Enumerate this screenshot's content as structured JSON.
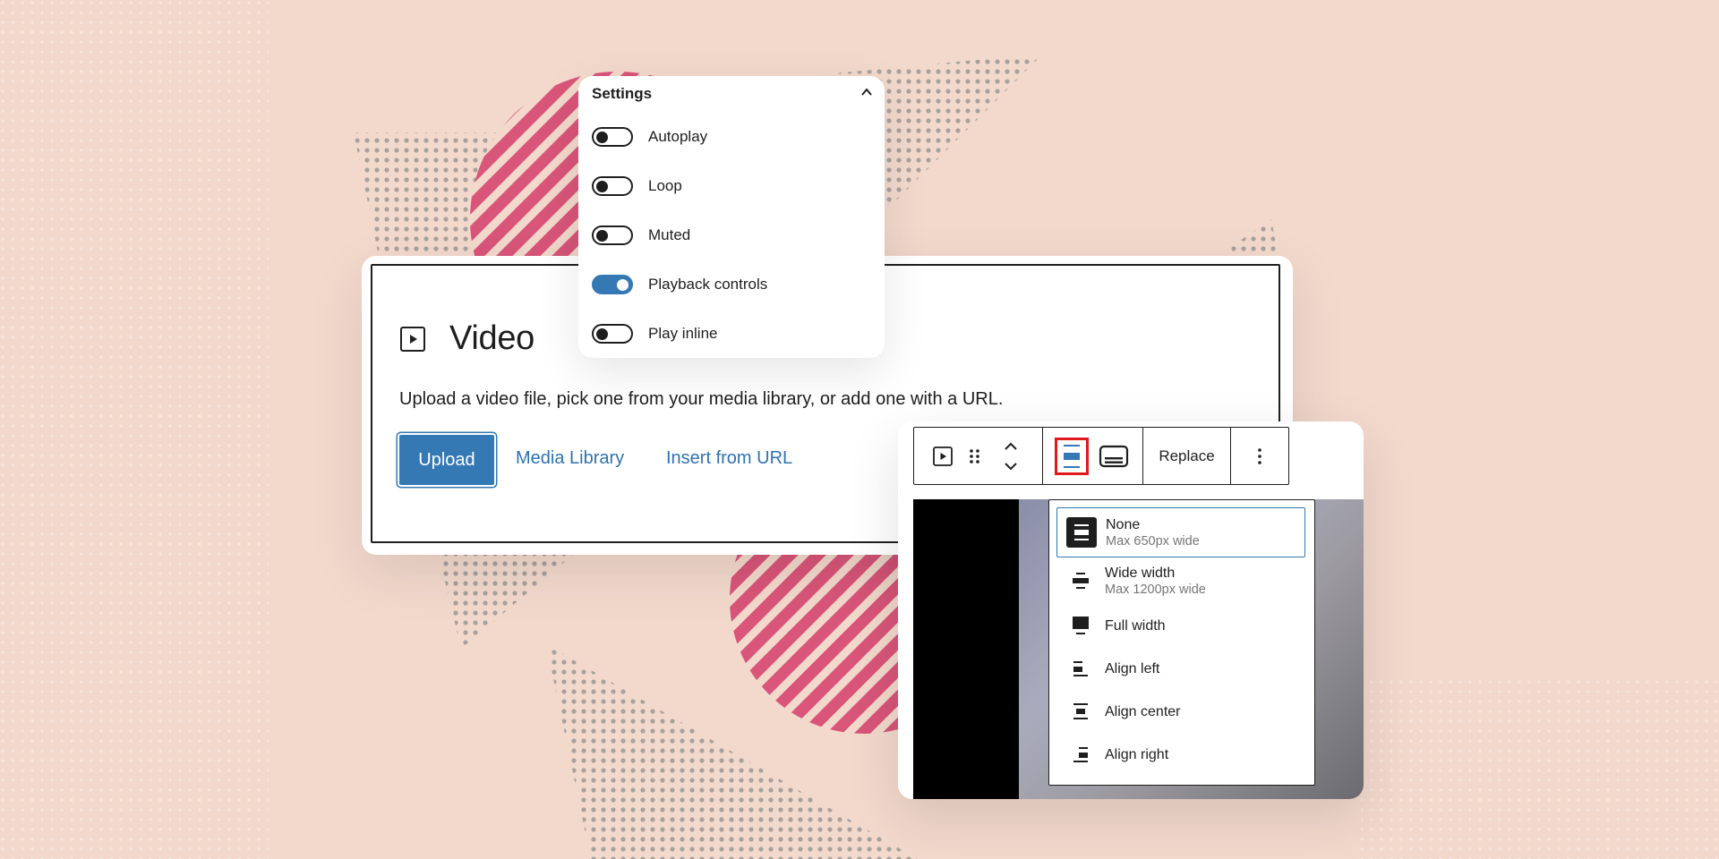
{
  "colors": {
    "background": "#f3d9cc",
    "accent": "#3479b4",
    "stripe": "#d9557a",
    "dots": "#8f8f8f",
    "highlight": "#e0191d",
    "text": "#1e1e1e",
    "muted": "#757575"
  },
  "settings": {
    "title": "Settings",
    "collapse_icon": "chevron-up-icon",
    "options": [
      {
        "label": "Autoplay",
        "enabled": false
      },
      {
        "label": "Loop",
        "enabled": false
      },
      {
        "label": "Muted",
        "enabled": false
      },
      {
        "label": "Playback controls",
        "enabled": true
      },
      {
        "label": "Play inline",
        "enabled": false
      }
    ]
  },
  "video_block": {
    "icon": "video-play-icon",
    "title": "Video",
    "description": "Upload a video file, pick one from your media library, or add one with a URL.",
    "upload_label": "Upload",
    "media_library_label": "Media Library",
    "insert_url_label": "Insert from URL"
  },
  "toolbar": {
    "icons": [
      "video-play-icon",
      "drag-handle-icon",
      "move-up-down-icon",
      "align-none-icon",
      "caption-icon",
      "more-vertical-icon"
    ],
    "replace_label": "Replace"
  },
  "alignment_menu": {
    "items": [
      {
        "label": "None",
        "sub": "Max 650px wide",
        "icon": "align-none-icon",
        "selected": true
      },
      {
        "label": "Wide width",
        "sub": "Max 1200px wide",
        "icon": "align-wide-icon",
        "selected": false
      },
      {
        "label": "Full width",
        "sub": "",
        "icon": "align-full-icon",
        "selected": false
      },
      {
        "label": "Align left",
        "sub": "",
        "icon": "align-left-icon",
        "selected": false
      },
      {
        "label": "Align center",
        "sub": "",
        "icon": "align-center-icon",
        "selected": false
      },
      {
        "label": "Align right",
        "sub": "",
        "icon": "align-right-icon",
        "selected": false
      }
    ]
  }
}
